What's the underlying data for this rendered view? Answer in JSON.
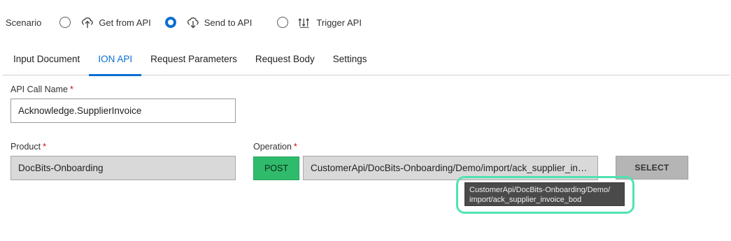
{
  "scenario": {
    "label": "Scenario",
    "options": [
      {
        "label": "Get from API",
        "checked": false,
        "icon": "cloud-download-icon"
      },
      {
        "label": "Send to API",
        "checked": true,
        "icon": "cloud-upload-icon"
      },
      {
        "label": "Trigger API",
        "checked": false,
        "icon": "trigger-arrows-icon"
      }
    ]
  },
  "tabs": [
    "Input Document",
    "ION API",
    "Request Parameters",
    "Request Body",
    "Settings"
  ],
  "active_tab": "ION API",
  "form": {
    "api_call_name": {
      "label": "API Call Name",
      "required_mark": "*",
      "value": "Acknowledge.SupplierInvoice"
    },
    "product": {
      "label": "Product",
      "required_mark": "*",
      "value": "DocBits-Onboarding"
    },
    "operation": {
      "label": "Operation",
      "required_mark": "*",
      "method": "POST",
      "value": "CustomerApi/DocBits-Onboarding/Demo/import/ack_supplier_in…",
      "select_label": "SELECT"
    }
  },
  "tooltip": {
    "line1": "CustomerApi/DocBits-Onboarding/Demo/",
    "line2": "import/ack_supplier_invoice_bod"
  },
  "colors": {
    "accent": "#0a6ed1",
    "post": "#2fbb6b",
    "required": "#d0021b",
    "highlight": "#4fe3b2"
  }
}
